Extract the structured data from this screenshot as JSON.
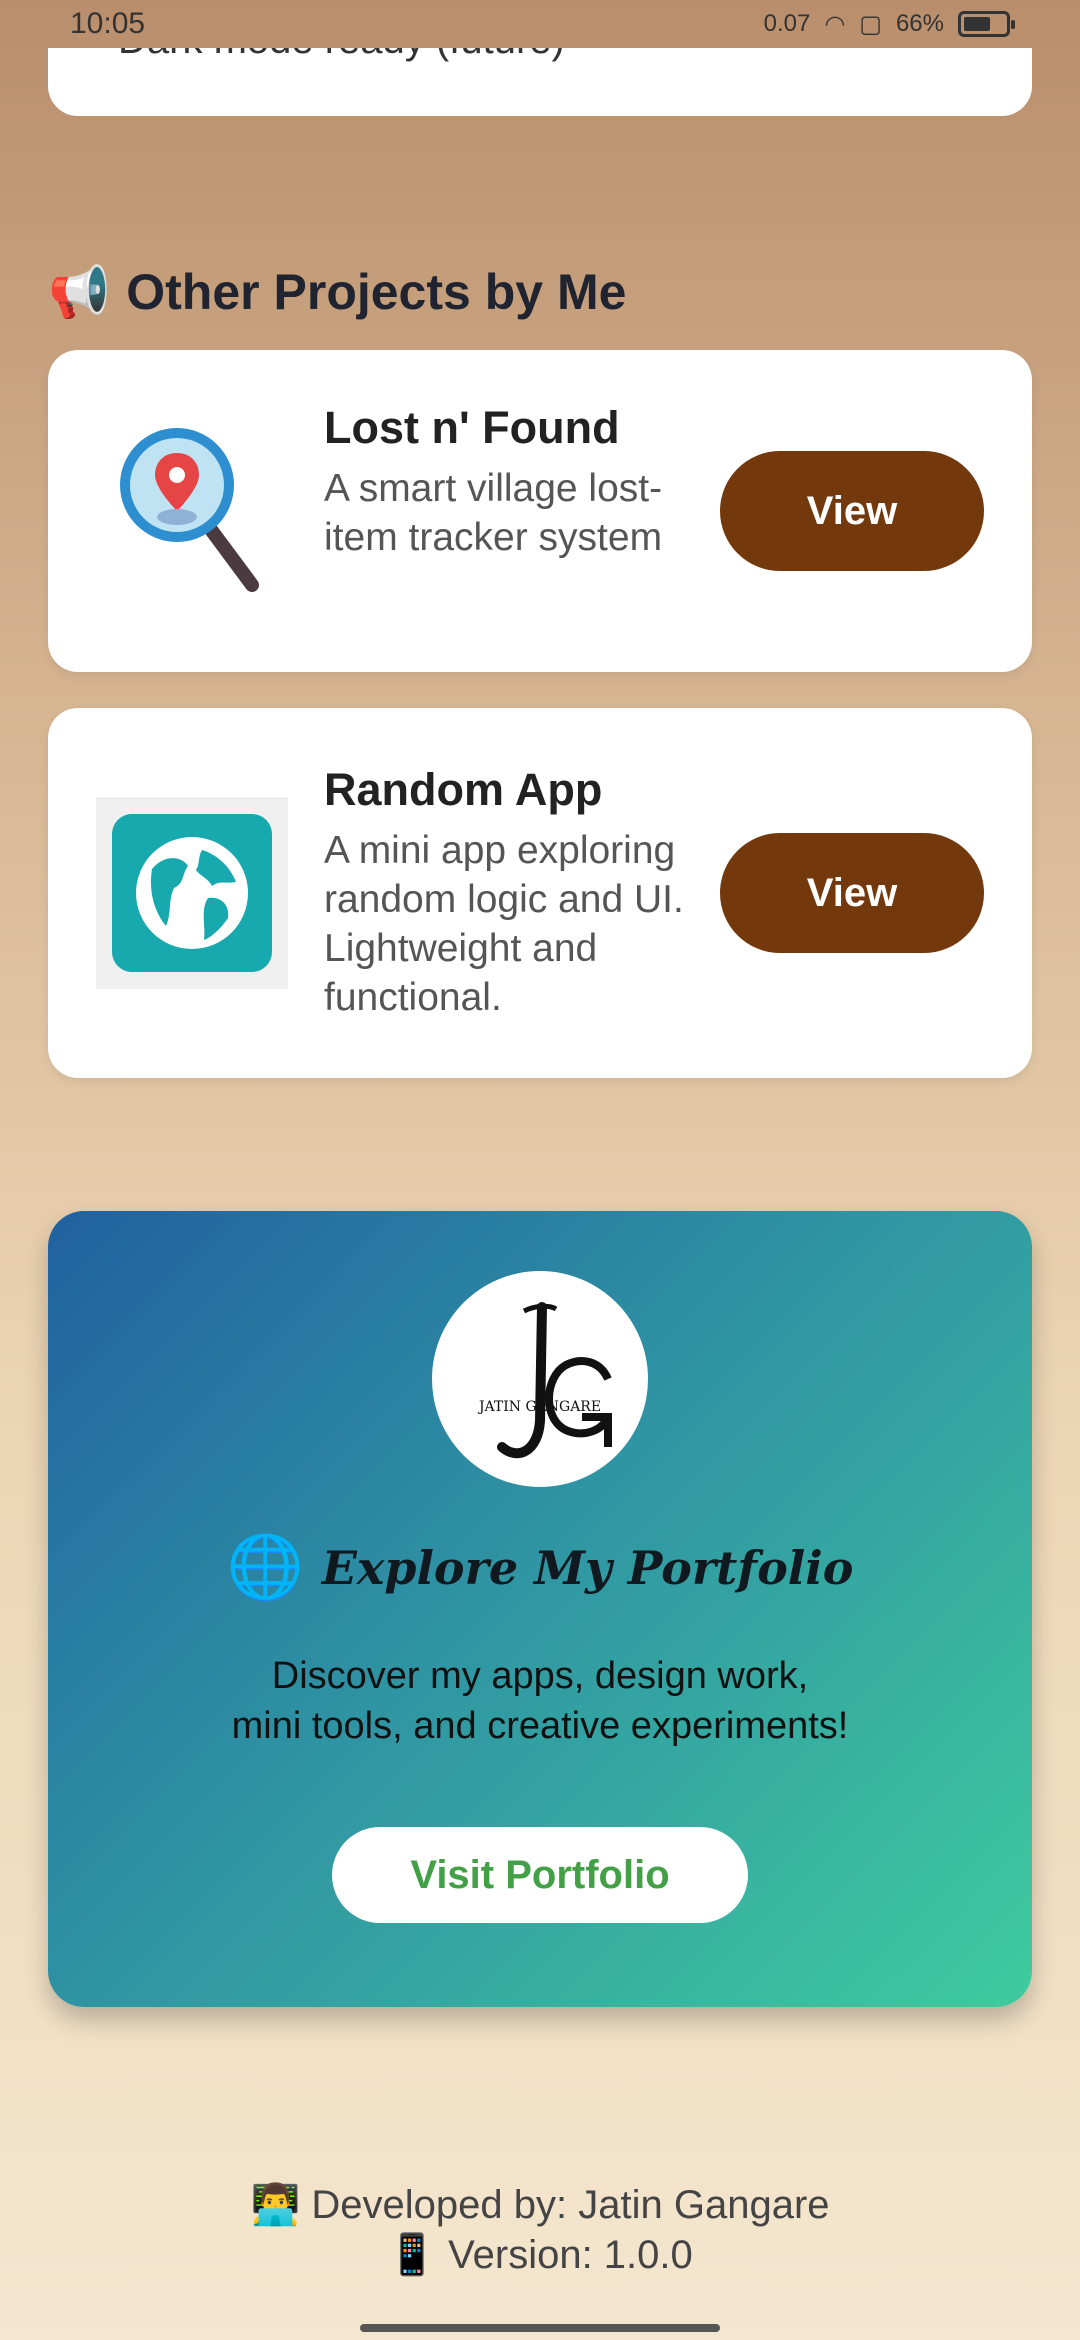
{
  "status_bar": {
    "time": "10:05",
    "speed": "0.07",
    "battery": "66%",
    "battery_level": 0.66
  },
  "top_card": {
    "text": "Dark mode ready (future)"
  },
  "section": {
    "icon": "megaphone-icon",
    "title": "Other Projects by Me"
  },
  "projects": [
    {
      "name": "Lost n' Found",
      "description": "A smart village lost-item tracker system",
      "icon": "magnifier-location-icon",
      "button": "View"
    },
    {
      "name": "Random App",
      "description": "A mini app exploring random logic and UI. Lightweight and functional.",
      "icon": "globe-app-icon",
      "button": "View"
    }
  ],
  "portfolio": {
    "logo_text": "JATIN GANGARE",
    "logo_monogram": "JG",
    "icon": "globe-icon",
    "title": "Explore My Portfolio",
    "description_line1": "Discover my apps, design work,",
    "description_line2": "mini tools, and creative experiments!",
    "button": "Visit Portfolio"
  },
  "footer": {
    "developer": "👨‍💻 Developed by: Jatin Gangare",
    "version": "📱 Version: 1.0.0"
  },
  "colors": {
    "view_button": "#73380b",
    "visit_button_text": "#43a047",
    "portfolio_gradient_start": "#2061a0",
    "portfolio_gradient_end": "#3fcb9e"
  }
}
